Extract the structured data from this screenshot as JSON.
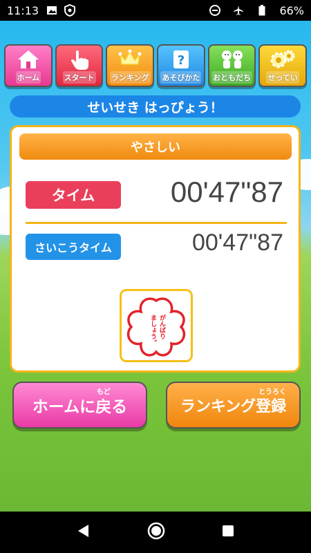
{
  "status_bar": {
    "time": "11:13",
    "battery": "66%",
    "left_icons": [
      "image-icon",
      "shield-icon"
    ],
    "right_icons": [
      "minus-circle-icon",
      "airplane-icon",
      "battery-icon"
    ]
  },
  "nav": {
    "home": "ホーム",
    "start": "スタート",
    "ranking": "ランキング",
    "howto": "あそびかた",
    "friends": "おともだち",
    "settings": "せってい"
  },
  "banner": {
    "text": "せいせき はっぴょう！"
  },
  "result": {
    "difficulty": "やさしい",
    "time_label": "タイム",
    "time_value": "00'47\"87",
    "best_label": "さいこうタイム",
    "best_value": "00'47\"87",
    "stamp_text_1": "がんばり",
    "stamp_text_2": "ましょう。"
  },
  "buttons": {
    "home": "ホームに戻る",
    "home_ruby": "もど",
    "ranking": "ランキング登録",
    "ranking_ruby": "とうろく"
  },
  "colors": {
    "banner": "#1c86e6",
    "card_border": "#f5b417",
    "time_label": "#ea3f5a",
    "best_label": "#2393e8",
    "stamp": "#e3232a"
  }
}
